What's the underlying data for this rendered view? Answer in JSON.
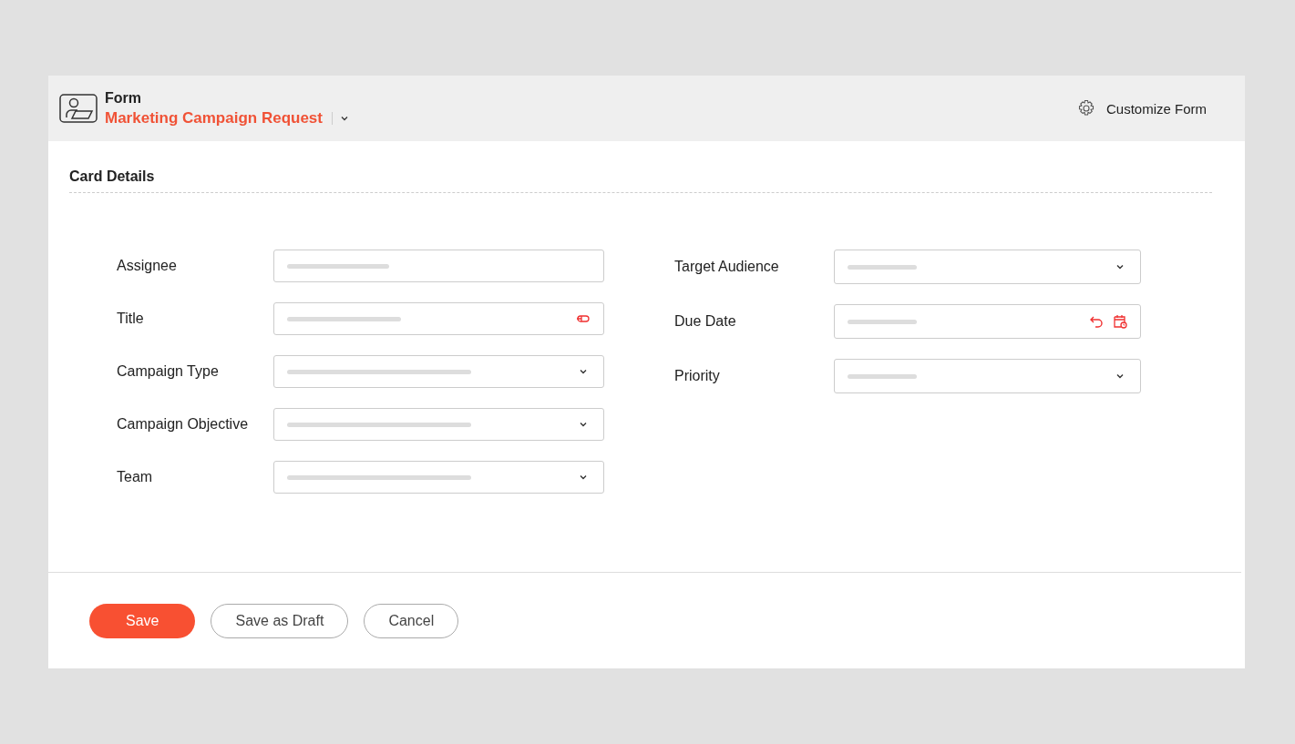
{
  "header": {
    "label": "Form",
    "form_name": "Marketing Campaign Request",
    "customize": "Customize Form"
  },
  "section": {
    "title": "Card Details"
  },
  "columns": [
    {
      "fields": [
        {
          "label": "Assignee",
          "kind": "text"
        },
        {
          "label": "Title",
          "kind": "tag"
        },
        {
          "label": "Campaign Type",
          "kind": "dropdown"
        },
        {
          "label": "Campaign Objective",
          "kind": "dropdown"
        },
        {
          "label": "Team",
          "kind": "dropdown"
        }
      ]
    },
    {
      "fields": [
        {
          "label": "Target Audience",
          "kind": "dropdown"
        },
        {
          "label": "Due Date",
          "kind": "date"
        },
        {
          "label": "Priority",
          "kind": "dropdown"
        }
      ]
    }
  ],
  "buttons": [
    {
      "label": "Save",
      "kind": "primary"
    },
    {
      "label": "Save as Draft",
      "kind": "secondary"
    },
    {
      "label": "Cancel",
      "kind": "secondary"
    }
  ]
}
